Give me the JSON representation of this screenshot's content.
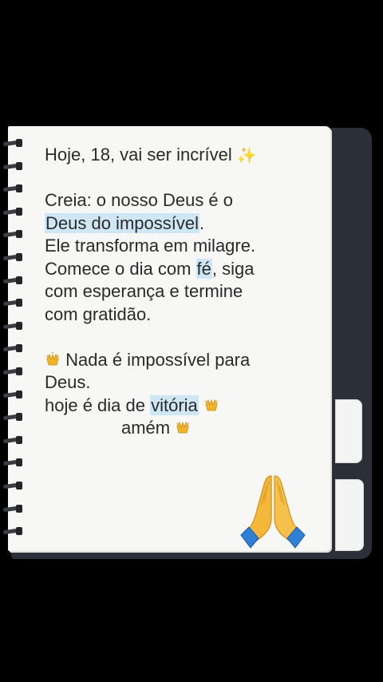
{
  "note": {
    "line1": "Hoje, 18, vai ser incrível",
    "line1_emoji": "✨",
    "creia_line": "Creia: o nosso Deus é o",
    "deus_impossivel": "Deus do impossível",
    "deus_impossivel_end": ".",
    "transforma": "Ele transforma em milagre.",
    "comece_pre": "Comece o dia com ",
    "fe": "fé",
    "comece_post": ", siga",
    "esperanca": "com esperança e termine",
    "gratidao": "com gratidão.",
    "nada": "Nada é impossível para",
    "deus": "Deus.",
    "hoje_pre": "hoje é dia de ",
    "vitoria": "vitória",
    "amem": "amém"
  },
  "icons": {
    "sparkle": "sparkles-icon",
    "raised_hands": "raising-hands-icon",
    "praying_hands": "folded-hands-icon"
  },
  "colors": {
    "highlight": "#cfe7f4",
    "page": "#f7f7f6",
    "cover": "#2b3038"
  }
}
